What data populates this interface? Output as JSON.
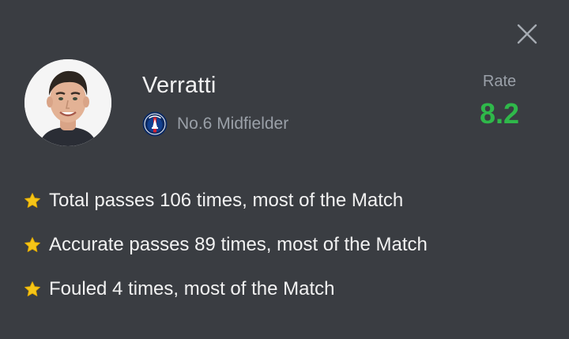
{
  "player": {
    "name": "Verratti",
    "position": "No.6 Midfielder",
    "avatar_icon": "player-photo",
    "club_icon": "psg-crest-icon"
  },
  "rating": {
    "label": "Rate",
    "value": "8.2",
    "color": "#2fb84a"
  },
  "close": {
    "icon": "close-icon"
  },
  "highlights": [
    {
      "icon": "star-icon",
      "text": "Total passes 106 times, most of the Match"
    },
    {
      "icon": "star-icon",
      "text": "Accurate passes 89 times, most of the Match"
    },
    {
      "icon": "star-icon",
      "text": "Fouled 4 times, most of the Match"
    }
  ],
  "colors": {
    "background": "#3a3d42",
    "primary_text": "#f2f2f2",
    "secondary_text": "#9aa0a8",
    "star": "#f5c518"
  }
}
